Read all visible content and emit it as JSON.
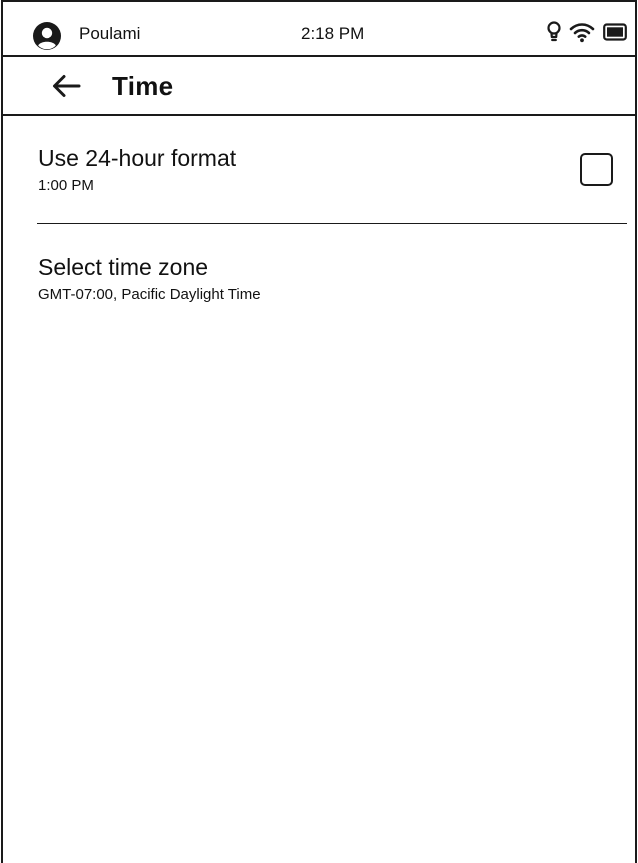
{
  "status_bar": {
    "user_name": "Poulami",
    "time": "2:18 PM",
    "icons": [
      "avatar-icon",
      "light-bulb-icon",
      "wifi-icon",
      "battery-icon"
    ]
  },
  "header": {
    "back_icon": "back-arrow-icon",
    "title": "Time"
  },
  "settings": {
    "hour_format": {
      "title": "Use 24-hour format",
      "subtitle": "1:00 PM",
      "checked": false
    },
    "time_zone": {
      "title": "Select time zone",
      "subtitle": "GMT-07:00, Pacific Daylight Time"
    }
  },
  "colors": {
    "ink": "#1a1a1a",
    "background": "#ffffff"
  }
}
